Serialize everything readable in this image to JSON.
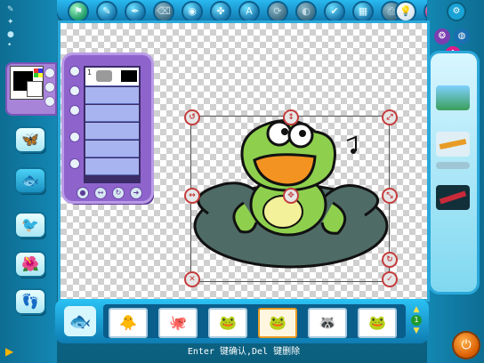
{
  "toolbar": {
    "buttons": [
      {
        "name": "green-flag-button",
        "icon": "⚑"
      },
      {
        "name": "brush-button",
        "icon": "✎"
      },
      {
        "name": "pen-button",
        "icon": "✒"
      },
      {
        "name": "eraser-button",
        "icon": "⌫"
      },
      {
        "name": "fill-button",
        "icon": "◉"
      },
      {
        "name": "stamp-button",
        "icon": "✤"
      },
      {
        "name": "text-button",
        "icon": "A"
      },
      {
        "name": "transform-button",
        "icon": "⟳"
      },
      {
        "name": "mask-button",
        "icon": "◐"
      },
      {
        "name": "check-button",
        "icon": "✔"
      },
      {
        "name": "film-button",
        "icon": "▦"
      },
      {
        "name": "print-button",
        "icon": "⎙"
      }
    ],
    "help_label": "?",
    "bulb_icon": "💡"
  },
  "layers": {
    "first_layer_number": "1"
  },
  "stickers": [
    {
      "name": "sticker-bird",
      "icon": "🐥"
    },
    {
      "name": "sticker-octopus",
      "icon": "🐙"
    },
    {
      "name": "sticker-frog-small",
      "icon": "🐸"
    },
    {
      "name": "sticker-frog-pad",
      "icon": "🐸"
    },
    {
      "name": "sticker-raccoon",
      "icon": "🦝"
    },
    {
      "name": "sticker-frog-water",
      "icon": "🐸"
    }
  ],
  "tray": {
    "page_number": "1"
  },
  "status_text": "Enter 键确认,Del 键删除",
  "colors": {
    "accent": "#2aa8da",
    "panel": "#8e64cc",
    "selection_handle": "#c43d3d",
    "frog_green": "#8ed04e",
    "frog_mouth": "#f39321",
    "lily_pad": "#4f6b66"
  }
}
